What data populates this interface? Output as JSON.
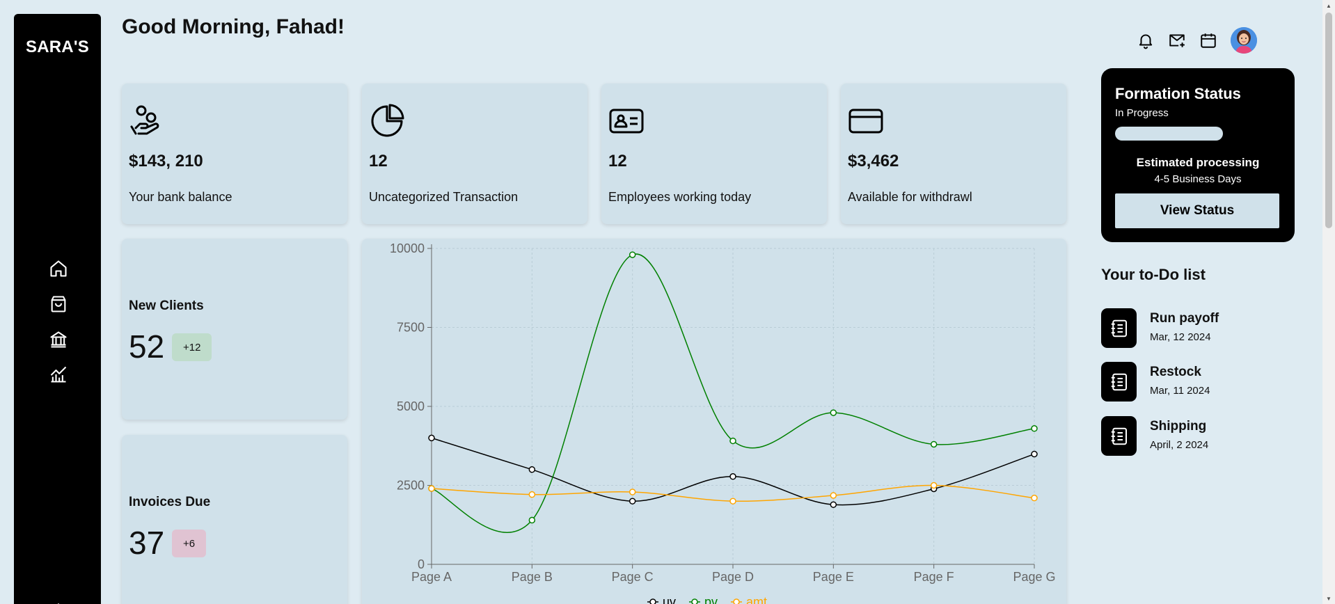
{
  "brand": {
    "logo": "SARA'S"
  },
  "header": {
    "greeting": "Good Morning, Fahad!"
  },
  "top_icons": [
    "bell-icon",
    "mail-plus-icon",
    "calendar-icon"
  ],
  "sidebar": {
    "items": [
      "home-icon",
      "shopping-bag-icon",
      "bank-icon",
      "analytics-icon",
      "settings-icon"
    ]
  },
  "stats": [
    {
      "icon": "hand-coins-icon",
      "value": "$143, 210",
      "label": "Your bank balance"
    },
    {
      "icon": "pie-chart-icon",
      "value": "12",
      "label": "Uncategorized Transaction"
    },
    {
      "icon": "id-card-icon",
      "value": "12",
      "label": "Employees working today"
    },
    {
      "icon": "credit-card-icon",
      "value": "$3,462",
      "label": "Available for withdrawl"
    }
  ],
  "clients": {
    "new": {
      "title": "New Clients",
      "value": "52",
      "badge": "+12",
      "badge_color": "#bfdccb"
    },
    "invoices": {
      "title": "Invoices Due",
      "value": "37",
      "badge": "+6",
      "badge_color": "#e0c3d2"
    }
  },
  "formation": {
    "title": "Formation Status",
    "status": "In Progress",
    "progress": 0,
    "estimate_title": "Estimated processing",
    "estimate_value": "4-5 Business Days",
    "button": "View Status"
  },
  "todo": {
    "heading": "Your to-Do list",
    "items": [
      {
        "title": "Run payoff",
        "date": "Mar, 12 2024"
      },
      {
        "title": "Restock",
        "date": "Mar, 11 2024"
      },
      {
        "title": "Shipping",
        "date": "April, 2 2024"
      }
    ]
  },
  "chart_data": {
    "type": "line",
    "categories": [
      "Page A",
      "Page B",
      "Page C",
      "Page D",
      "Page E",
      "Page F",
      "Page G"
    ],
    "ylim": [
      0,
      10000
    ],
    "yticks": [
      0,
      2500,
      5000,
      7500,
      10000
    ],
    "grid": true,
    "legend_position": "bottom",
    "series": [
      {
        "name": "uv",
        "color": "#000000",
        "values": [
          4000,
          3000,
          2000,
          2780,
          1890,
          2390,
          3490
        ]
      },
      {
        "name": "pv",
        "color": "#008000",
        "values": [
          2400,
          1398,
          9800,
          3908,
          4800,
          3800,
          4300
        ]
      },
      {
        "name": "amt",
        "color": "#ffa500",
        "values": [
          2400,
          2210,
          2290,
          2000,
          2181,
          2500,
          2100
        ]
      }
    ]
  }
}
